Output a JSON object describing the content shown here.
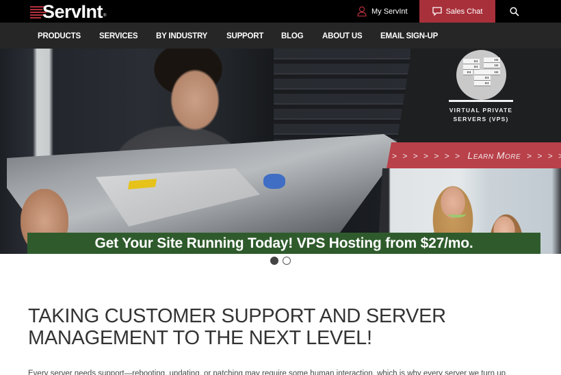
{
  "header": {
    "logo_text": "ServInt",
    "logo_tm": "®",
    "my_account_label": "My ServInt",
    "sales_chat_label": "Sales Chat",
    "search_icon": "search-icon",
    "colors": {
      "topbar": "#000000",
      "accent": "#a8303a",
      "nav": "#262626"
    }
  },
  "nav": {
    "items": [
      {
        "label": "PRODUCTS"
      },
      {
        "label": "SERVICES"
      },
      {
        "label": "BY INDUSTRY"
      },
      {
        "label": "SUPPORT"
      },
      {
        "label": "BLOG"
      },
      {
        "label": "ABOUT US"
      },
      {
        "label": "EMAIL SIGN-UP"
      }
    ]
  },
  "hero": {
    "vps_title_line1": "VIRTUAL PRIVATE",
    "vps_title_line2": "SERVERS (VPS)",
    "learn_more_prefix": "> > > > > > >",
    "learn_more_label": "Learn More",
    "learn_more_suffix": "> > > > > >",
    "promo_text": "Get Your Site Running Today! VPS Hosting from $27/mo.",
    "colors": {
      "promo_bg": "#2f5b2c",
      "learn_band": "#b8414a",
      "vps_panel": "#1e1f21"
    }
  },
  "carousel": {
    "slides": 2,
    "active_index": 0
  },
  "main": {
    "headline": "TAKING CUSTOMER SUPPORT AND SERVER MANAGEMENT TO THE NEXT LEVEL!",
    "body": "Every server needs support—rebooting, updating, or patching may require some human interaction, which is why every server we turn up"
  }
}
